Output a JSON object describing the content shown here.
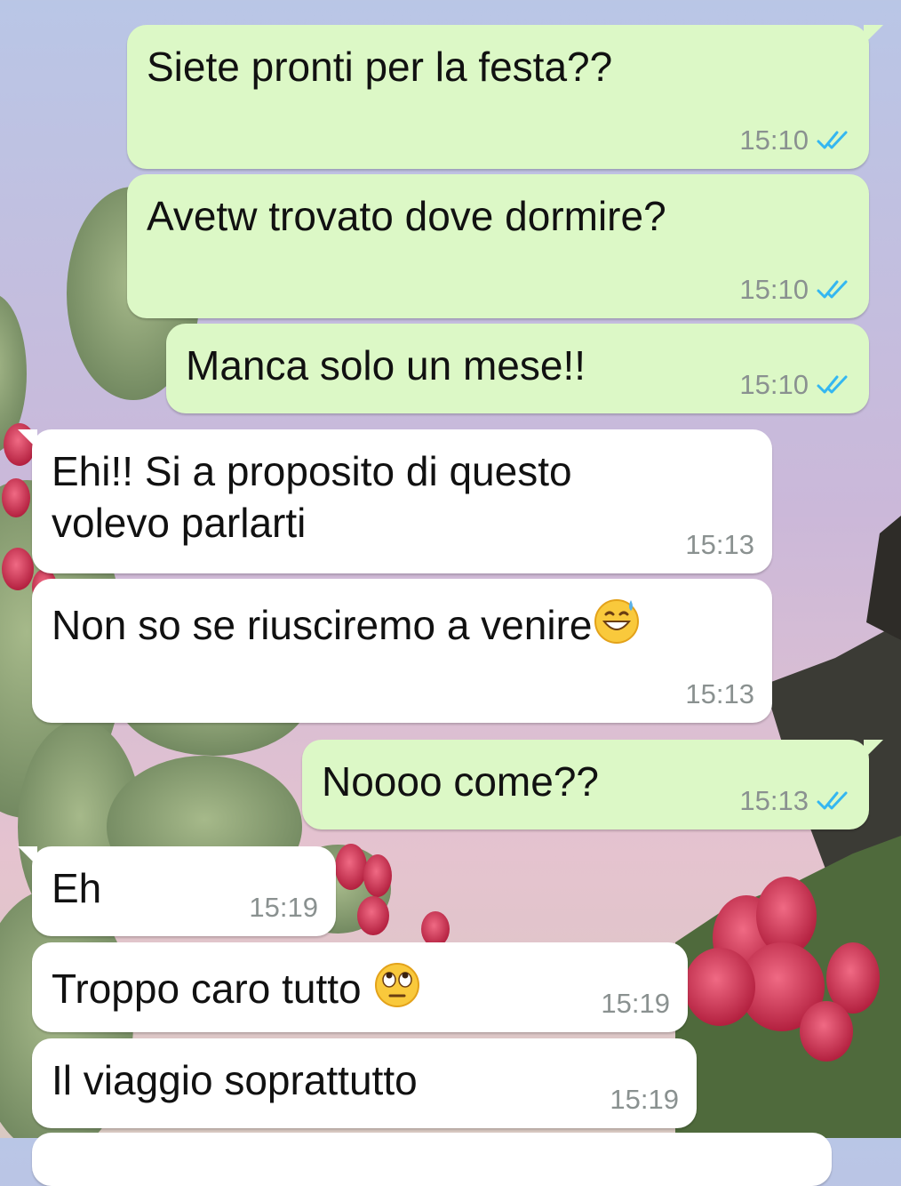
{
  "colors": {
    "outgoing_bubble": "#dcf8c6",
    "incoming_bubble": "#ffffff",
    "read_ticks": "#34b7f1",
    "time_text": "#8a9190"
  },
  "messages": [
    {
      "text": "Siete pronti per la festa??",
      "time": "15:10",
      "direction": "outgoing",
      "status": "read"
    },
    {
      "text": "Avetw trovato dove dormire?",
      "time": "15:10",
      "direction": "outgoing",
      "status": "read"
    },
    {
      "text": "Manca solo un mese!!",
      "time": "15:10",
      "direction": "outgoing",
      "status": "read"
    },
    {
      "text_line1": "Ehi!! Si a proposito di questo",
      "text_line2": "volevo parlarti",
      "time": "15:13",
      "direction": "incoming"
    },
    {
      "text": "Non so se riusciremo a venire",
      "emoji": "grinning-sweat-emoji",
      "time": "15:13",
      "direction": "incoming"
    },
    {
      "text": "Noooo come??",
      "time": "15:13",
      "direction": "outgoing",
      "status": "read"
    },
    {
      "text": "Eh",
      "time": "15:19",
      "direction": "incoming"
    },
    {
      "text": "Troppo caro tutto ",
      "emoji": "eye-roll-emoji",
      "time": "15:19",
      "direction": "incoming"
    },
    {
      "text": "Il viaggio soprattutto",
      "time": "15:19",
      "direction": "incoming"
    }
  ]
}
